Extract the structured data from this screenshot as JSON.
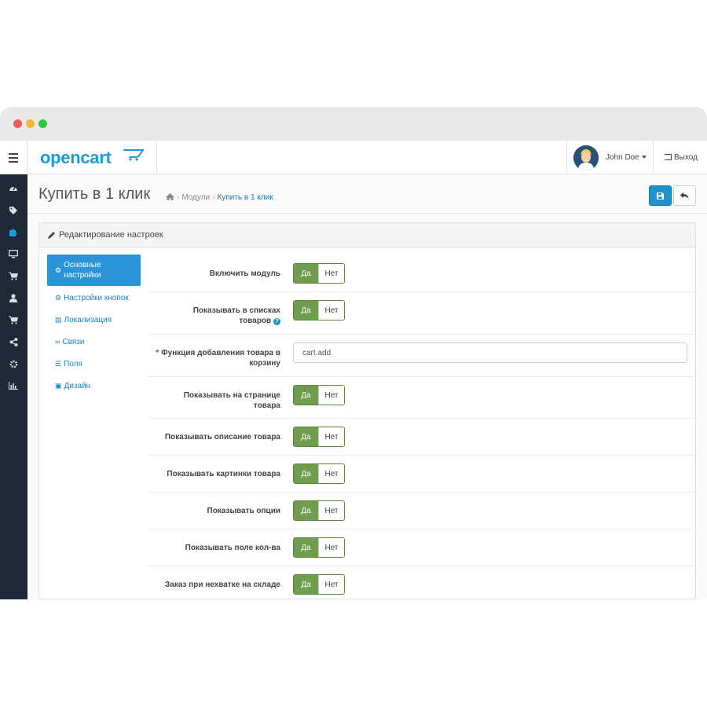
{
  "window": {
    "colors": {
      "close": "#ee5b55",
      "minimize": "#f3b737",
      "maximize": "#2ec53f"
    }
  },
  "header": {
    "logo": "opencart",
    "user": {
      "name": "John Doe"
    },
    "logout_label": "Выход"
  },
  "sidebar": {
    "icons": [
      "dashboard-icon",
      "tags-icon",
      "puzzle-icon",
      "desktop-icon",
      "cart-icon",
      "user-icon",
      "cart-icon",
      "share-icon",
      "cog-icon",
      "bar-chart-icon"
    ],
    "active_index": 2
  },
  "page": {
    "title": "Купить в 1 клик",
    "breadcrumbs": [
      "Модули",
      "Купить в 1 клик"
    ]
  },
  "panel": {
    "title": "Редактирование настроек",
    "tabs": [
      {
        "label": "Основные настройки",
        "icon": "cogs-icon"
      },
      {
        "label": "Настройки кнопок",
        "icon": "cog-icon"
      },
      {
        "label": "Локализация",
        "icon": "language-icon"
      },
      {
        "label": "Связи",
        "icon": "link-icon"
      },
      {
        "label": "Поля",
        "icon": "list-icon"
      },
      {
        "label": "Дизайн",
        "icon": "image-icon"
      }
    ]
  },
  "form": {
    "yes_label": "Да",
    "no_label": "Нет",
    "fields": [
      {
        "label": "Включить модуль",
        "value": "Да"
      },
      {
        "label": "Показывать в списках товаров",
        "value": "Да"
      },
      {
        "label": "Функция добавления товара в корзину",
        "required": true,
        "input_value": "cart.add"
      },
      {
        "label": "Показывать на странице товара",
        "value": "Да"
      },
      {
        "label": "Показывать описание товара",
        "value": "Да"
      },
      {
        "label": "Показывать картинки товара",
        "value": "Да"
      },
      {
        "label": "Показывать опции",
        "value": "Да"
      },
      {
        "label": "Показывать поле кол-ва",
        "value": "Да"
      },
      {
        "label": "Заказ при нехватке на складе",
        "value": "Да"
      }
    ]
  },
  "colors": {
    "brand": "#1c9bd8",
    "sidebar": "#1e2836",
    "toggle_on": "#6e9d4d",
    "primary_button": "#1e91cf"
  }
}
